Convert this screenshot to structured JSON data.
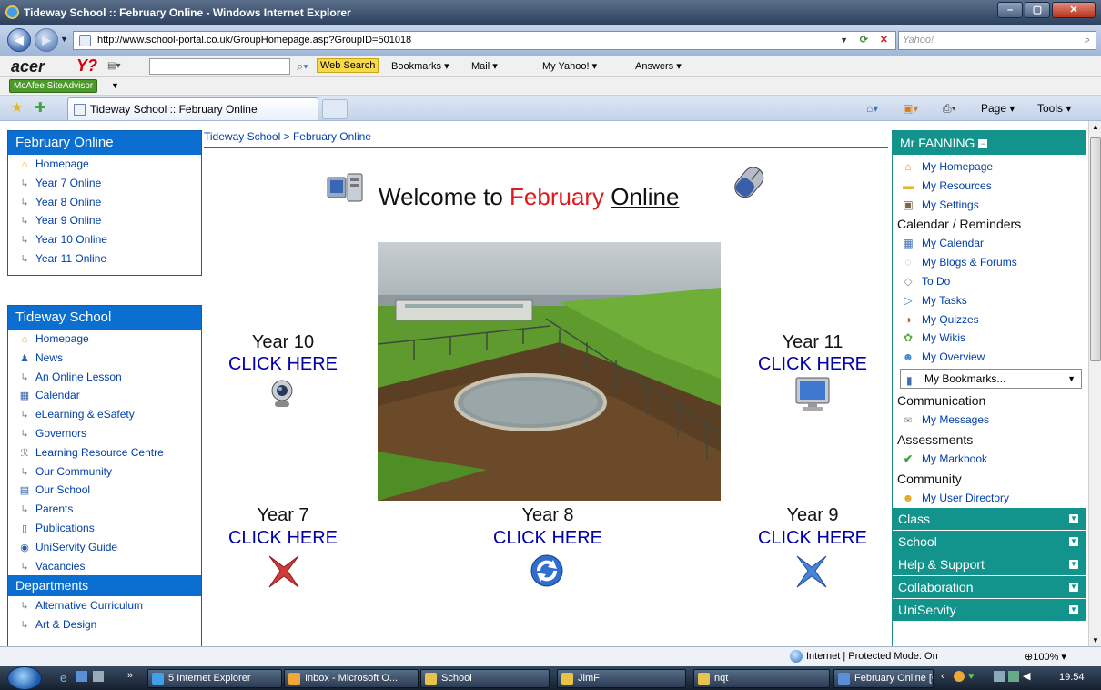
{
  "window": {
    "title": "Tideway School :: February Online - Windows Internet Explorer",
    "btn_min": "–",
    "btn_max": "▢",
    "btn_close": "✕"
  },
  "address": {
    "url": "http://www.school-portal.co.uk/GroupHomepage.asp?GroupID=501018",
    "search_placeholder": "Yahoo!"
  },
  "toolbar": {
    "brand": "acer",
    "yahoo": "Y?",
    "web_search": "Web Search",
    "items": [
      "Bookmarks ▾",
      "Mail ▾",
      "My Yahoo! ▾",
      "Answers ▾"
    ]
  },
  "mcafee": {
    "label": "McAfee SiteAdvisor"
  },
  "tabs": {
    "active": "Tideway School :: February Online",
    "commands": [
      "Page ▾",
      "Tools ▾"
    ]
  },
  "breadcrumb": "Tideway School > February Online",
  "left": {
    "group1": {
      "title": "February Online",
      "items": [
        {
          "label": "Homepage",
          "icon": "home-icon"
        },
        {
          "label": "Year 7 Online",
          "icon": "arrow-icon"
        },
        {
          "label": "Year 8 Online",
          "icon": "arrow-icon"
        },
        {
          "label": "Year 9 Online",
          "icon": "arrow-icon"
        },
        {
          "label": "Year 10 Online",
          "icon": "arrow-icon"
        },
        {
          "label": "Year 11 Online",
          "icon": "arrow-icon"
        }
      ]
    },
    "group2": {
      "title": "Tideway School",
      "items": [
        {
          "label": "Homepage",
          "icon": "home-icon"
        },
        {
          "label": "News",
          "icon": "news-icon"
        },
        {
          "label": "An Online Lesson",
          "icon": "arrow-icon"
        },
        {
          "label": "Calendar",
          "icon": "calendar-icon"
        },
        {
          "label": "eLearning & eSafety",
          "icon": "arrow-icon"
        },
        {
          "label": "Governors",
          "icon": "arrow-icon"
        },
        {
          "label": "Learning Resource Centre",
          "icon": "lrc-icon"
        },
        {
          "label": "Our Community",
          "icon": "arrow-icon"
        },
        {
          "label": "Our School",
          "icon": "school-icon"
        },
        {
          "label": "Parents",
          "icon": "arrow-icon"
        },
        {
          "label": "Publications",
          "icon": "document-icon"
        },
        {
          "label": "UniServity Guide",
          "icon": "uniservity-icon"
        },
        {
          "label": "Vacancies",
          "icon": "arrow-icon"
        }
      ]
    },
    "group3": {
      "title": "Departments",
      "items": [
        {
          "label": "Alternative Curriculum",
          "icon": "arrow-icon"
        },
        {
          "label": "Art & Design",
          "icon": "arrow-icon"
        }
      ]
    }
  },
  "main": {
    "welcome_prefix": "Welcome to ",
    "welcome_red": "February",
    "welcome_suffix": "Online",
    "years": [
      {
        "label": "Year 10",
        "link": "CLICK HERE"
      },
      {
        "label": "Year 11",
        "link": "CLICK HERE"
      },
      {
        "label": "Year 7",
        "link": "CLICK HERE"
      },
      {
        "label": "Year 8",
        "link": "CLICK HERE"
      },
      {
        "label": "Year 9",
        "link": "CLICK HERE"
      }
    ]
  },
  "right": {
    "user": "Mr FANNING",
    "links1": [
      "My Homepage",
      "My Resources",
      "My Settings"
    ],
    "sec_calendar": "Calendar / Reminders",
    "links2": [
      "My Calendar",
      "My Blogs & Forums",
      "To Do",
      "My Tasks",
      "My Quizzes",
      "My Wikis",
      "My Overview"
    ],
    "bookmarks_select": "My Bookmarks...",
    "sec_comm": "Communication",
    "messages": "My Messages",
    "sec_assess": "Assessments",
    "markbook": "My Markbook",
    "sec_community": "Community",
    "user_directory": "My User Directory",
    "collapsibles": [
      "Class",
      "School",
      "Help & Support",
      "Collaboration",
      "UniServity"
    ]
  },
  "status": {
    "zone": "Internet | Protected Mode: On",
    "zoom": "100%"
  },
  "taskbar": {
    "buttons": [
      "5 Internet Explorer",
      "Inbox - Microsoft O...",
      "School",
      "JimF",
      "nqt",
      "February Online [Co..."
    ],
    "clock": "19:54"
  },
  "colors": {
    "accent_blue": "#0a6fd1",
    "teal": "#12938c",
    "link": "#003fa8",
    "red": "#e0191b"
  }
}
